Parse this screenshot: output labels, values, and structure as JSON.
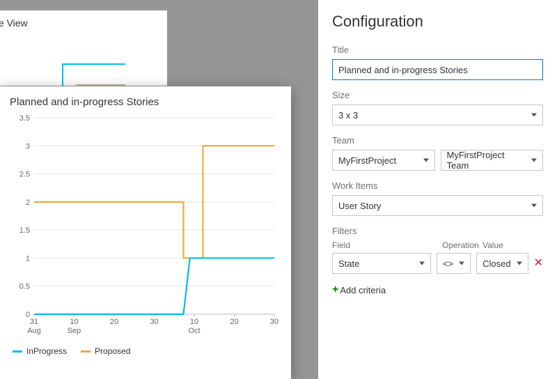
{
  "left": {
    "bg_card_title": "w Profile View",
    "preview_title": "Planned and in-progress Stories",
    "legend": {
      "inprogress": {
        "label": "InProgress",
        "color": "#00bcf2"
      },
      "proposed": {
        "label": "Proposed",
        "color": "#f2a93b"
      }
    }
  },
  "panel": {
    "heading": "Configuration",
    "title_label": "Title",
    "title_value": "Planned and in-progress Stories",
    "size_label": "Size",
    "size_value": "3 x 3",
    "team_label": "Team",
    "team_project": "MyFirstProject",
    "team_team": "MyFirstProject Team",
    "workitems_label": "Work Items",
    "workitems_value": "User Story",
    "filters_label": "Filters",
    "filters_cols": {
      "field": "Field",
      "op": "Operation",
      "value": "Value"
    },
    "filter_row": {
      "field": "State",
      "op": "<>",
      "value": "Closed"
    },
    "add_criteria": "Add criteria"
  },
  "chart_data": {
    "type": "line",
    "title": "Planned and in-progress Stories",
    "xlabel": "",
    "ylabel": "",
    "ylim": [
      0,
      3.5
    ],
    "yticks": [
      0,
      0.5,
      1,
      1.5,
      2,
      2.5,
      3,
      3.5
    ],
    "x_categories": [
      "31 Aug",
      "10 Sep",
      "20",
      "30",
      "10 Oct",
      "20",
      "30"
    ],
    "x_index_range": [
      0,
      37
    ],
    "series": [
      {
        "name": "Proposed",
        "color": "#f2a93b",
        "points": [
          {
            "x": 0,
            "y": 2
          },
          {
            "x": 23,
            "y": 2
          },
          {
            "x": 23,
            "y": 1
          },
          {
            "x": 26,
            "y": 1
          },
          {
            "x": 26,
            "y": 3
          },
          {
            "x": 37,
            "y": 3
          }
        ]
      },
      {
        "name": "InProgress",
        "color": "#00bcf2",
        "points": [
          {
            "x": 0,
            "y": 0
          },
          {
            "x": 23,
            "y": 0
          },
          {
            "x": 24,
            "y": 1
          },
          {
            "x": 37,
            "y": 1
          }
        ]
      }
    ],
    "x_tick_positions": [
      0,
      10,
      20,
      30,
      40,
      50,
      60
    ]
  }
}
